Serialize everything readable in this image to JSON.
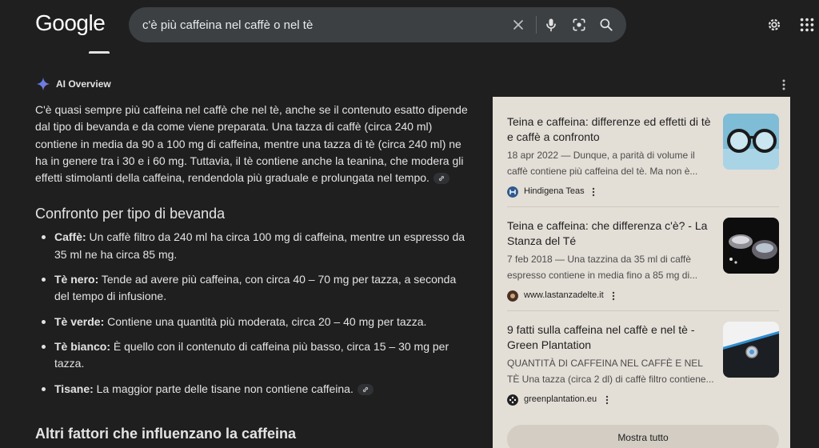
{
  "header": {
    "logo": "Google",
    "search_query": "c'è più caffeina nel caffè o nel tè",
    "icons": [
      "close-icon",
      "mic-icon",
      "lens-icon",
      "search-icon",
      "settings-icon",
      "apps-icon"
    ]
  },
  "ai_overview": {
    "label": "AI Overview",
    "intro": "C'è quasi sempre più caffeina nel caffè che nel tè, anche se il contenuto esatto dipende dal tipo di bevanda e da come viene preparata. Una tazza di caffè (circa 240 ml) contiene in media da 90 a 100 mg di caffeina, mentre una tazza di tè (circa 240 ml) ne ha in genere tra i 30 e i 60 mg. Tuttavia, il tè contiene anche la teanina, che modera gli effetti stimolanti della caffeina, rendendola più graduale e prolungata nel tempo.",
    "section1_title": "Confronto per tipo di bevanda",
    "items": [
      {
        "term": "Caffè:",
        "text": " Un caffè filtro da 240 ml ha circa 100 mg di caffeina, mentre un espresso da 35 ml ne ha circa 85 mg."
      },
      {
        "term": "Tè nero:",
        "text": " Tende ad avere più caffeina, con circa 40 – 70 mg per tazza, a seconda del tempo di infusione."
      },
      {
        "term": "Tè verde:",
        "text": " Contiene una quantità più moderata, circa 20 – 40 mg per tazza."
      },
      {
        "term": "Tè bianco:",
        "text": " È quello con il contenuto di caffeina più basso, circa 15 – 30 mg per tazza."
      },
      {
        "term": "Tisane:",
        "text": " La maggior parte delle tisane non contiene caffeina."
      }
    ],
    "section2_title": "Altri fattori che influenzano la caffeina"
  },
  "sources": {
    "cards": [
      {
        "title": "Teina e caffeina: differenze ed effetti di tè e caffè a confronto",
        "snippet": "18 apr 2022 — Dunque, a parità di volume il caffè contiene più caffeina del tè. Ma non è...",
        "source": "Hindigena Teas"
      },
      {
        "title": "Teina e caffeina: che differenza c'è? - La Stanza del Té",
        "snippet": "7 feb 2018 — Una tazzina da 35 ml di caffè espresso contiene in media fino a 85 mg di...",
        "source": "www.lastanzadelte.it"
      },
      {
        "title": "9 fatti sulla caffeina nel caffè e nel tè - Green Plantation",
        "snippet": "QUANTITÀ DI CAFFEINA NEL CAFFÈ E NEL TÈ Una tazza (circa 2 dl) di caffè filtro contiene...",
        "source": "greenplantation.eu"
      }
    ],
    "show_all": "Mostra tutto"
  }
}
